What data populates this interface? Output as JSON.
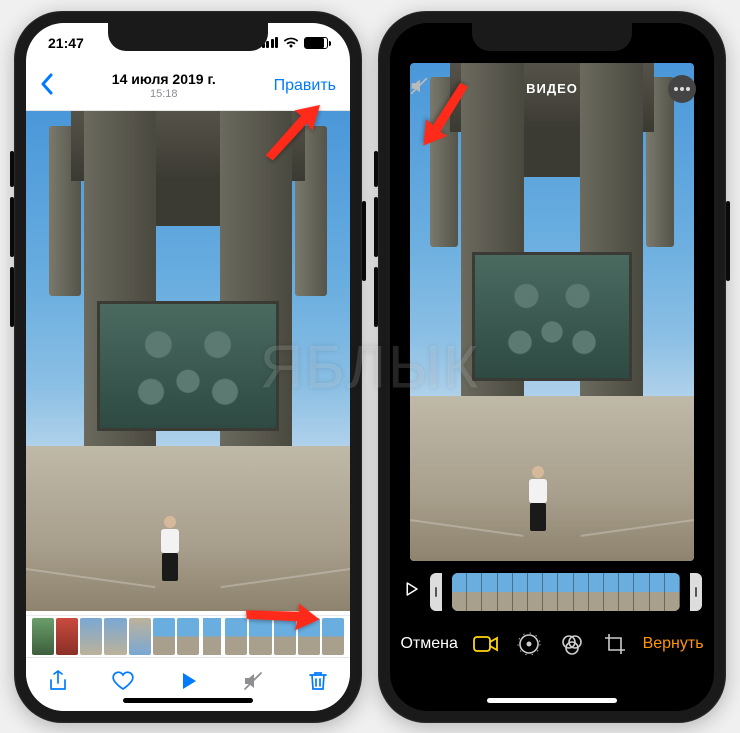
{
  "watermark": "ЯБЛЫК",
  "colors": {
    "ios_blue": "#007aff",
    "ios_grey": "#8e8e93",
    "ios_orange": "#ff9500",
    "arrow": "#ff2a1a"
  },
  "left": {
    "status_time": "21:47",
    "nav_date": "14 июля 2019 г.",
    "nav_time": "15:18",
    "edit_label": "Править",
    "thumb_count": 13,
    "selected_thumb_index": 7,
    "icons": {
      "back": "chevron-left",
      "share": "share-icon",
      "like": "heart-icon",
      "play": "play-icon",
      "mute": "mute-icon",
      "trash": "trash-icon"
    }
  },
  "right": {
    "title": "ВИДЕО",
    "cancel_label": "Отмена",
    "revert_label": "Вернуть",
    "timeline_frames": 15,
    "tools": [
      "video",
      "adjust",
      "filters",
      "crop"
    ],
    "selected_tool_index": 0,
    "icons": {
      "mute": "mute-icon",
      "more": "ellipsis-icon",
      "play": "play-icon"
    }
  }
}
